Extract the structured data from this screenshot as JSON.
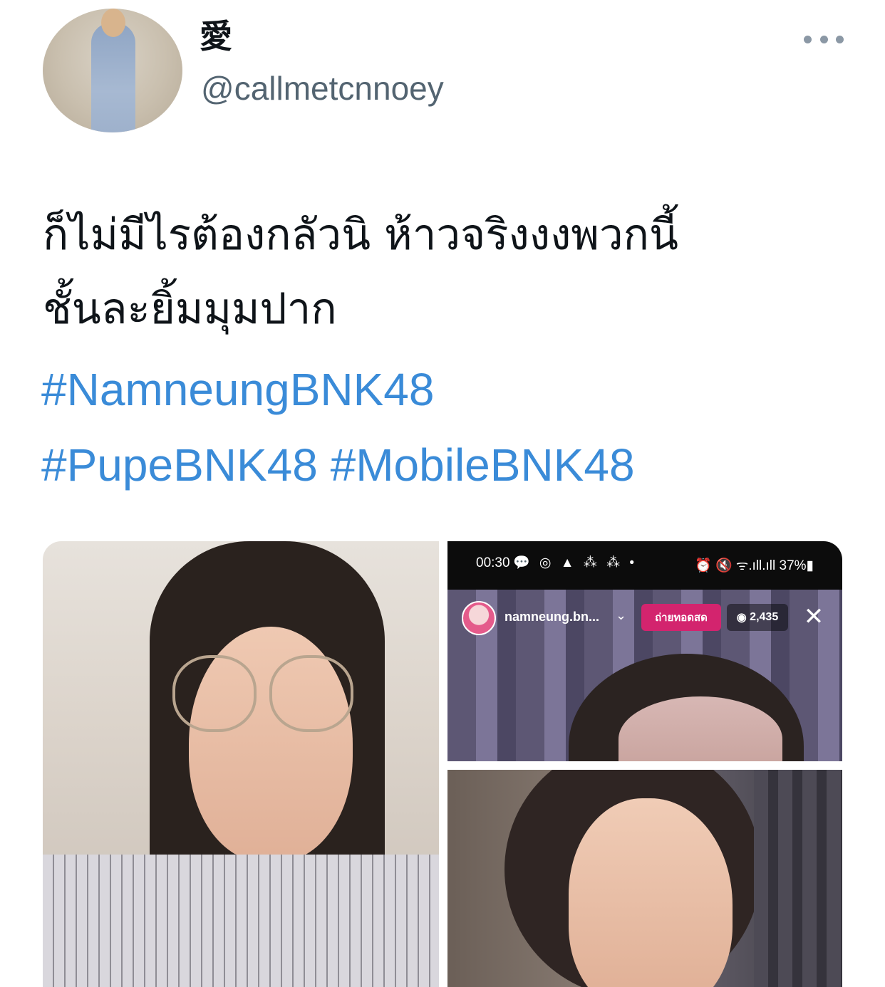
{
  "author": {
    "display_name": "愛",
    "handle": "@callmetcnnoey"
  },
  "tweet": {
    "text_lines": [
      "ก็ไม่มีไรต้องกลัวนิ ห้าวจริงงงพวกนี้",
      "ชั้นละยิ้มมุมปาก"
    ],
    "hashtags": [
      "#NamneungBNK48",
      "#PupeBNK48",
      "#MobileBNK48"
    ]
  },
  "media": {
    "top_right": {
      "status_time": "00:30",
      "status_icons": "💬 ◎ ▲ ⁂ ⁂ •",
      "status_right": "⏰ 🔇 ᯤ.ıll.ıll 37%▮",
      "username": "namneung.bn...",
      "live_label": "ถ่ายทอดสด",
      "viewer_count": "2,435",
      "close_icon": "✕"
    }
  },
  "colors": {
    "hashtag": "#3a8bd8",
    "secondary_text": "#536471",
    "live_badge": "#d3246e"
  }
}
